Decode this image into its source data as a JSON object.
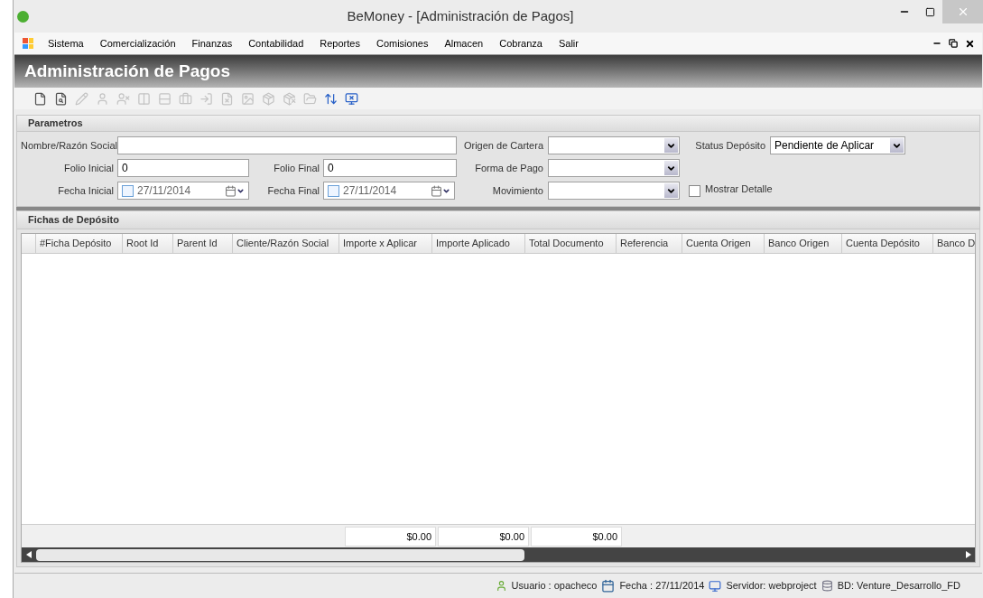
{
  "window": {
    "title": "BeMoney - [Administración de Pagos]"
  },
  "menu": [
    "Sistema",
    "Comercialización",
    "Finanzas",
    "Contabilidad",
    "Reportes",
    "Comisiones",
    "Almacen",
    "Cobranza",
    "Salir"
  ],
  "header": {
    "title": "Administración de Pagos"
  },
  "toolbar": [
    {
      "disabled": false
    },
    {
      "disabled": false
    },
    {
      "disabled": true
    },
    {
      "disabled": true
    },
    {
      "disabled": true
    },
    {
      "disabled": true
    },
    {
      "disabled": true
    },
    {
      "disabled": true
    },
    {
      "disabled": true
    },
    {
      "disabled": true
    },
    {
      "disabled": true
    },
    {
      "disabled": true
    },
    {
      "disabled": true
    },
    {
      "disabled": true
    },
    {
      "disabled": false
    },
    {
      "disabled": false
    }
  ],
  "parameters": {
    "title": "Parametros",
    "nombre": {
      "label": "Nombre/Razón Social"
    },
    "folio_inicial": {
      "label": "Folio Inicial",
      "value": "0"
    },
    "folio_final": {
      "label": "Folio Final",
      "value": "0"
    },
    "fecha_inicial": {
      "label": "Fecha Inicial",
      "value": "27/11/2014",
      "checked": false
    },
    "fecha_final": {
      "label": "Fecha Final",
      "value": "27/11/2014",
      "checked": false
    },
    "origen_cartera": {
      "label": "Origen de Cartera"
    },
    "forma_pago": {
      "label": "Forma de Pago"
    },
    "movimiento": {
      "label": "Movimiento"
    },
    "status_deposito": {
      "label": "Status Depósito",
      "value": "Pendiente de Aplicar"
    },
    "mostrar_detalle": {
      "label": "Mostrar Detalle",
      "checked": false
    }
  },
  "grid": {
    "title": "Fichas de Depósito",
    "columns": [
      "#Ficha Depósito",
      "Root Id",
      "Parent Id",
      "Cliente/Razón Social",
      "Importe x Aplicar",
      "Importe Aplicado",
      "Total Documento",
      "Referencia",
      "Cuenta Origen",
      "Banco Origen",
      "Cuenta Depósito",
      "Banco D"
    ],
    "totals": [
      "$0.00",
      "$0.00",
      "$0.00"
    ]
  },
  "status_bar": {
    "usuario": "Usuario : opacheco",
    "fecha": "Fecha : 27/11/2014",
    "servidor": "Servidor: webproject",
    "bd": "BD: Venture_Desarrollo_FD"
  }
}
